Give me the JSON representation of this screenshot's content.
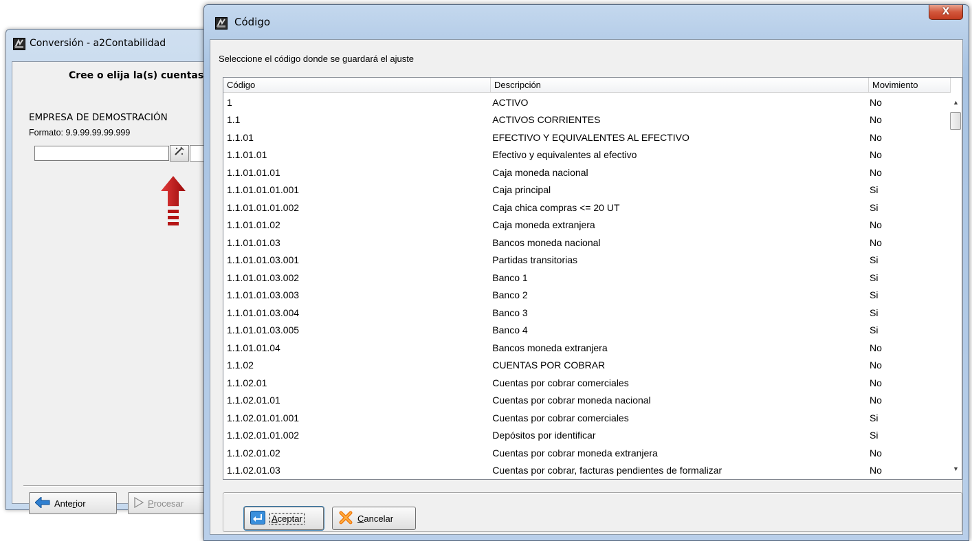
{
  "background_window": {
    "title": "Conversión - a2Contabilidad",
    "heading": "Cree o elija la(s) cuentas",
    "company": "EMPRESA DE DEMOSTRACIÓN",
    "format_label": "Formato: 9.9.99.99.99.999",
    "code_value": "",
    "prev_button": {
      "label_pre": "Ante",
      "label_ul": "r",
      "label_post": "ior"
    },
    "process_button": {
      "label_ul": "P",
      "label_post": "rocesar"
    }
  },
  "dialog": {
    "title": "Código",
    "close_label": "X",
    "prompt": "Seleccione el código donde se guardará el ajuste",
    "columns": [
      "Código",
      "Descripción",
      "Movimiento"
    ],
    "rows": [
      [
        "1",
        "ACTIVO",
        "No"
      ],
      [
        "1.1",
        "ACTIVOS CORRIENTES",
        "No"
      ],
      [
        "1.1.01",
        "EFECTIVO Y EQUIVALENTES AL EFECTIVO",
        "No"
      ],
      [
        "1.1.01.01",
        "Efectivo y equivalentes al efectivo",
        "No"
      ],
      [
        "1.1.01.01.01",
        "Caja moneda nacional",
        "No"
      ],
      [
        "1.1.01.01.01.001",
        "Caja principal",
        "Si"
      ],
      [
        "1.1.01.01.01.002",
        "Caja chica compras <= 20 UT",
        "Si"
      ],
      [
        "1.1.01.01.02",
        "Caja moneda extranjera",
        "No"
      ],
      [
        "1.1.01.01.03",
        "Bancos moneda nacional",
        "No"
      ],
      [
        "1.1.01.01.03.001",
        "Partidas transitorias",
        "Si"
      ],
      [
        "1.1.01.01.03.002",
        "Banco 1",
        "Si"
      ],
      [
        "1.1.01.01.03.003",
        "Banco 2",
        "Si"
      ],
      [
        "1.1.01.01.03.004",
        "Banco 3",
        "Si"
      ],
      [
        "1.1.01.01.03.005",
        "Banco 4",
        "Si"
      ],
      [
        "1.1.01.01.04",
        "Bancos moneda extranjera",
        "No"
      ],
      [
        "1.1.02",
        "CUENTAS POR COBRAR",
        "No"
      ],
      [
        "1.1.02.01",
        "Cuentas por cobrar comerciales",
        "No"
      ],
      [
        "1.1.02.01.01",
        "Cuentas por cobrar moneda nacional",
        "No"
      ],
      [
        "1.1.02.01.01.001",
        "Cuentas por cobrar comerciales",
        "Si"
      ],
      [
        "1.1.02.01.01.002",
        "Depósitos por identificar",
        "Si"
      ],
      [
        "1.1.02.01.02",
        "Cuentas por cobrar moneda extranjera",
        "No"
      ],
      [
        "1.1.02.01.03",
        "Cuentas por cobrar, facturas pendientes de formalizar",
        "No"
      ]
    ],
    "accept_button": {
      "label_ul": "A",
      "label_post": "ceptar"
    },
    "cancel_button": {
      "label_ul": "C",
      "label_post": "ancelar"
    }
  },
  "colors": {
    "accent": "#3c7fb1",
    "close": "#c23b20",
    "arrow": "#c01010"
  }
}
